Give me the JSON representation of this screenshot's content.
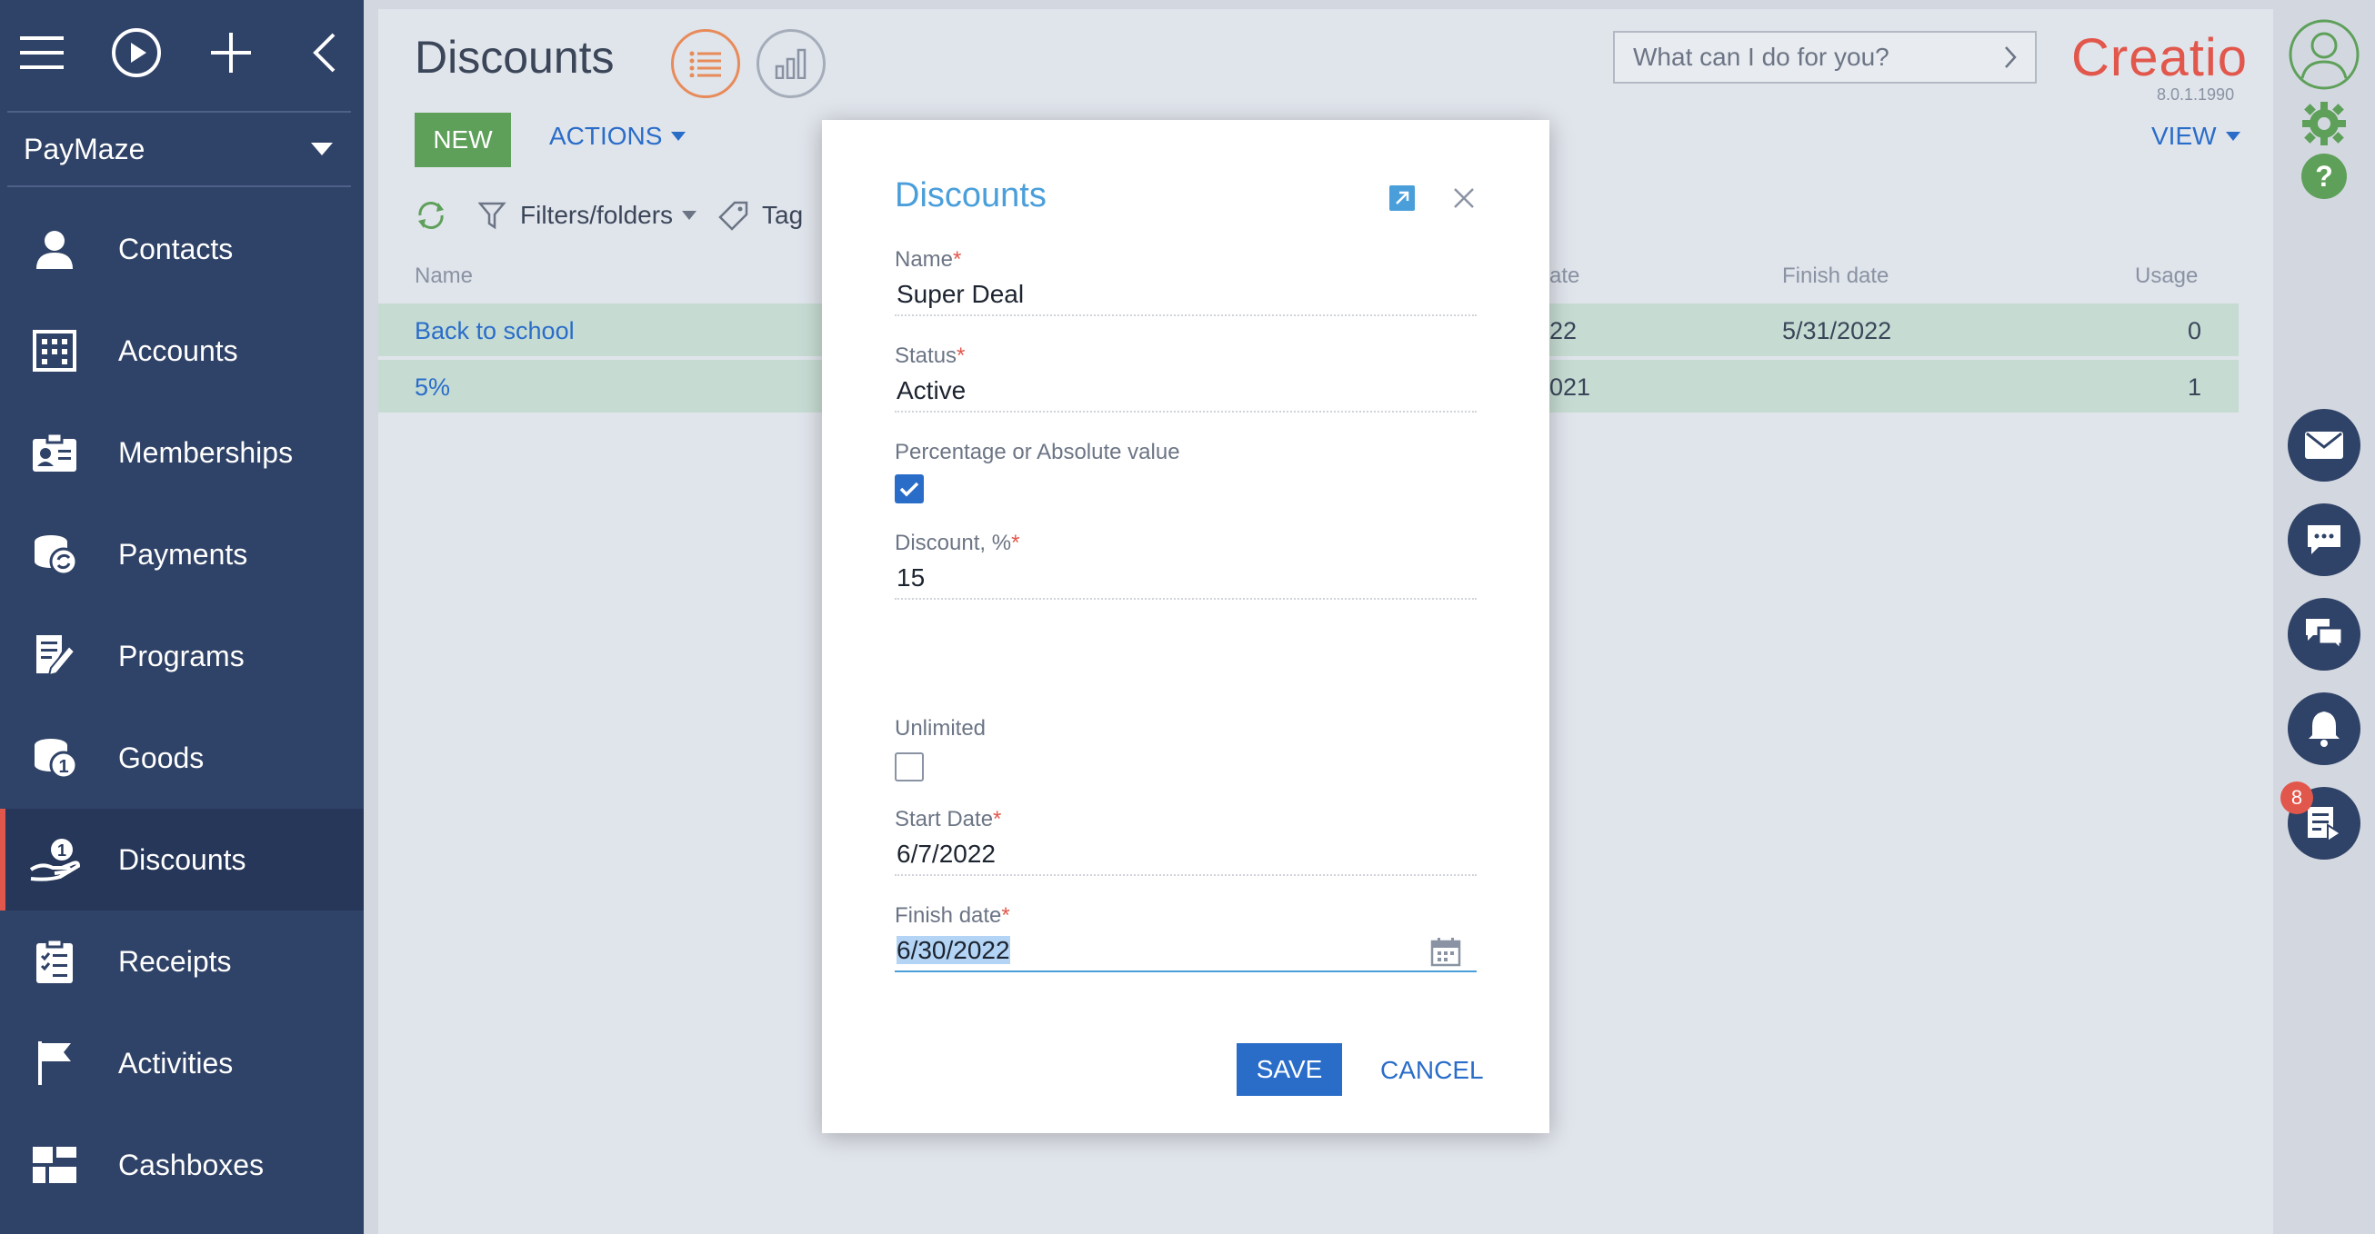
{
  "sidebar": {
    "workspace": "PayMaze",
    "items": [
      {
        "label": "Contacts",
        "icon": "contacts-icon"
      },
      {
        "label": "Accounts",
        "icon": "accounts-icon"
      },
      {
        "label": "Memberships",
        "icon": "memberships-icon"
      },
      {
        "label": "Payments",
        "icon": "payments-icon"
      },
      {
        "label": "Programs",
        "icon": "programs-icon"
      },
      {
        "label": "Goods",
        "icon": "goods-icon"
      },
      {
        "label": "Discounts",
        "icon": "discounts-icon",
        "active": true
      },
      {
        "label": "Receipts",
        "icon": "receipts-icon"
      },
      {
        "label": "Activities",
        "icon": "activities-icon"
      },
      {
        "label": "Cashboxes",
        "icon": "cashboxes-icon"
      }
    ]
  },
  "header": {
    "title": "Discounts",
    "search_placeholder": "What can I do for you?",
    "logo": "Creatio",
    "version": "8.0.1.1990",
    "view_label": "VIEW"
  },
  "toolbar": {
    "new_label": "NEW",
    "actions_label": "ACTIONS",
    "filters_label": "Filters/folders",
    "tag_label": "Tag"
  },
  "grid": {
    "columns": {
      "name": "Name",
      "start_date": "ate",
      "finish_date": "Finish date",
      "usage": "Usage"
    },
    "rows": [
      {
        "name": "Back to school",
        "start_date": "22",
        "finish_date": "5/31/2022",
        "usage": "0"
      },
      {
        "name": "5%",
        "start_date": "021",
        "finish_date": "",
        "usage": "1"
      }
    ]
  },
  "right_panel": {
    "notification_count": "8"
  },
  "modal": {
    "title": "Discounts",
    "fields": {
      "name_label": "Name",
      "name_value": "Super Deal",
      "status_label": "Status",
      "status_value": "Active",
      "percentage_label": "Percentage or Absolute value",
      "percentage_checked": true,
      "discount_label": "Discount, %",
      "discount_value": "15",
      "unlimited_label": "Unlimited",
      "unlimited_checked": false,
      "start_date_label": "Start Date",
      "start_date_value": "6/7/2022",
      "finish_date_label": "Finish date",
      "finish_date_value": "6/30/2022"
    },
    "save_label": "SAVE",
    "cancel_label": "CANCEL"
  },
  "colors": {
    "sidebar_bg": "#2f4267",
    "accent_blue": "#2a6dc9",
    "title_blue": "#4a9fdb",
    "new_green": "#5ea05a",
    "required_red": "#e2574c",
    "row_green": "#c6dcd3"
  }
}
